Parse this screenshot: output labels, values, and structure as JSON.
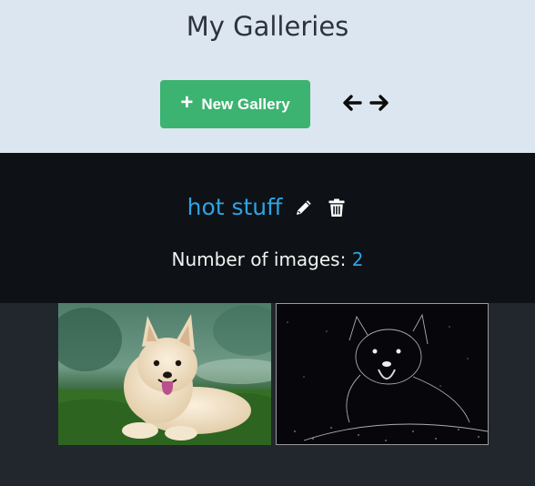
{
  "header": {
    "title": "My Galleries",
    "new_gallery_label": "New Gallery",
    "plus_icon": "plus-icon",
    "prev_icon": "arrow-left-icon",
    "next_icon": "arrow-right-icon",
    "accent_color": "#3cb371"
  },
  "gallery": {
    "name": "hot stuff",
    "edit_icon": "pencil-icon",
    "delete_icon": "trash-icon",
    "count_label": "Number of images:",
    "count_value": "2",
    "link_color": "#2ea3e3",
    "images": [
      {
        "subject": "dog-photo"
      },
      {
        "subject": "dog-photo-edge-filtered"
      }
    ]
  }
}
